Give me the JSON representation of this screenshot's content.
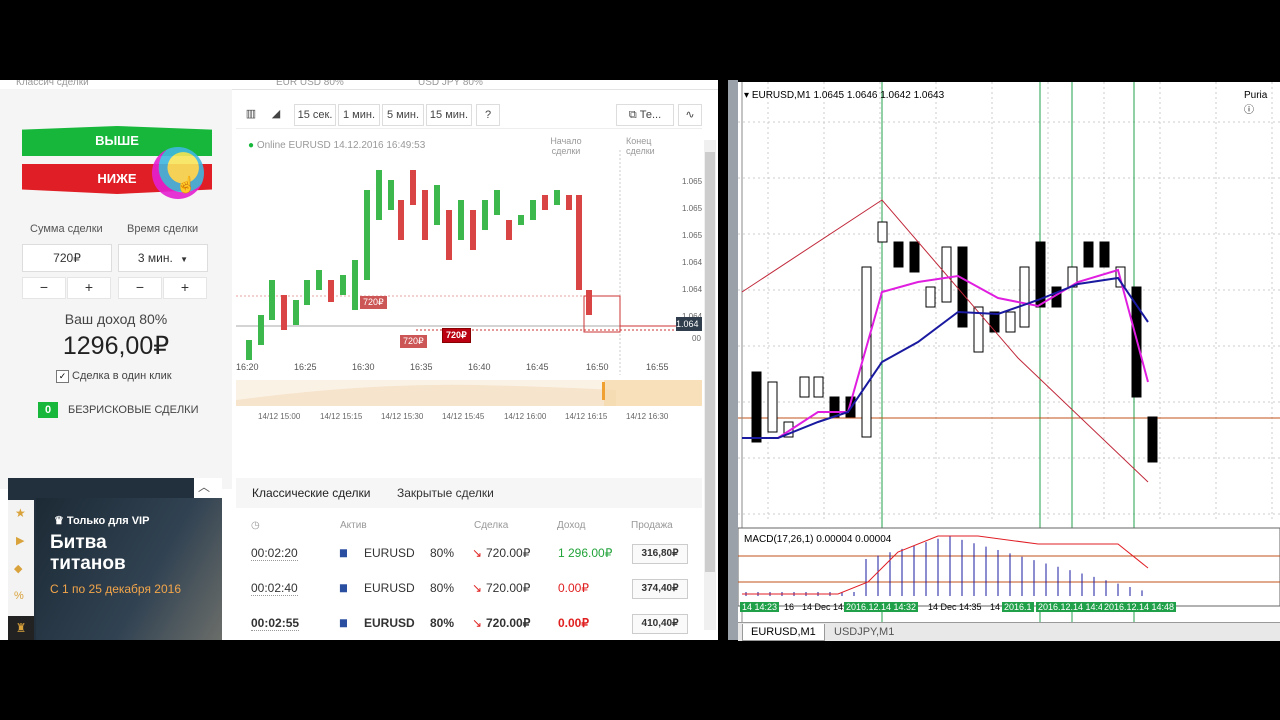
{
  "broker": {
    "top_pairs": [
      "EUR USD 80%",
      "USD JPY 80%"
    ],
    "top_link": "Классич сделки",
    "btn_up": "ВЫШЕ",
    "btn_down": "НИЖЕ",
    "amount_label": "Сумма сделки",
    "time_label": "Время сделки",
    "amount_value": "720₽",
    "time_value": "3 мин.",
    "minus": "−",
    "plus": "+",
    "income_label": "Ваш доход 80%",
    "income_value": "1296,00₽",
    "oneclick": "Сделка в один клик",
    "riskfree_count": "0",
    "riskfree_label": "БЕЗРИСКОВЫЕ СДЕЛКИ",
    "timeframes": [
      "15 сек.",
      "1 мин.",
      "5 мин.",
      "15 мин.",
      "?"
    ],
    "tools_label": "Те...",
    "online_text": "Online EURUSD 14.12.2016 16:49:53",
    "start_label": "Начало сделки",
    "end_label": "Конец сделки",
    "price_ticks": [
      "1.065",
      "1.065",
      "1.065",
      "1.064",
      "1.064",
      "1.064"
    ],
    "current_price": "1.064",
    "current_price2": "00",
    "time_ticks": [
      "16:20",
      "16:25",
      "16:30",
      "16:35",
      "16:40",
      "16:45",
      "16:50",
      "16:55"
    ],
    "nav_ticks": [
      "14/12 15:00",
      "14/12 15:15",
      "14/12 15:30",
      "14/12 15:45",
      "14/12 16:00",
      "14/12 16:15",
      "14/12 16:30"
    ],
    "marker_labels": [
      "720₽",
      "720₽",
      "720₽"
    ],
    "trades_tabs": [
      "Классические сделки",
      "Закрытые сделки"
    ],
    "trades_headers": [
      "Актив",
      "Сделка",
      "Доход",
      "Продажа"
    ],
    "trades": [
      {
        "time": "00:02:20",
        "asset": "EURUSD",
        "pct": "80%",
        "deal": "720.00₽",
        "income": "1 296.00₽",
        "sell": "316,80₽",
        "income_color": "#22a33a"
      },
      {
        "time": "00:02:40",
        "asset": "EURUSD",
        "pct": "80%",
        "deal": "720.00₽",
        "income": "0.00₽",
        "sell": "374,40₽",
        "income_color": "#e02020"
      },
      {
        "time": "00:02:55",
        "asset": "EURUSD",
        "pct": "80%",
        "deal": "720.00₽",
        "income": "0.00₽",
        "sell": "410,40₽",
        "income_color": "#e02020"
      }
    ],
    "vip_small": "Только для VIP",
    "vip_title1": "Битва",
    "vip_title2": "титанов",
    "vip_dates": "С 1 по 25 декабря 2016"
  },
  "mt4": {
    "header": "EURUSD,M1  1.0645 1.0646 1.0642 1.0643",
    "indicator_name": "Puria",
    "macd_label": "MACD(17,26,1) 0.00004 0.00004",
    "time_axis": [
      "14 14:23",
      "16",
      "14 Dec 14:30",
      "2016.12.14 14:32",
      "14 Dec 14:35",
      "14",
      "2016.1",
      "2016.12.14 14:44",
      "2016.12.14 14:48"
    ],
    "tabs": [
      "EURUSD,M1",
      "USDJPY,M1"
    ]
  },
  "colors": {
    "up": "#17b73c",
    "down": "#e01e25",
    "accent": "#2b8fd6"
  }
}
